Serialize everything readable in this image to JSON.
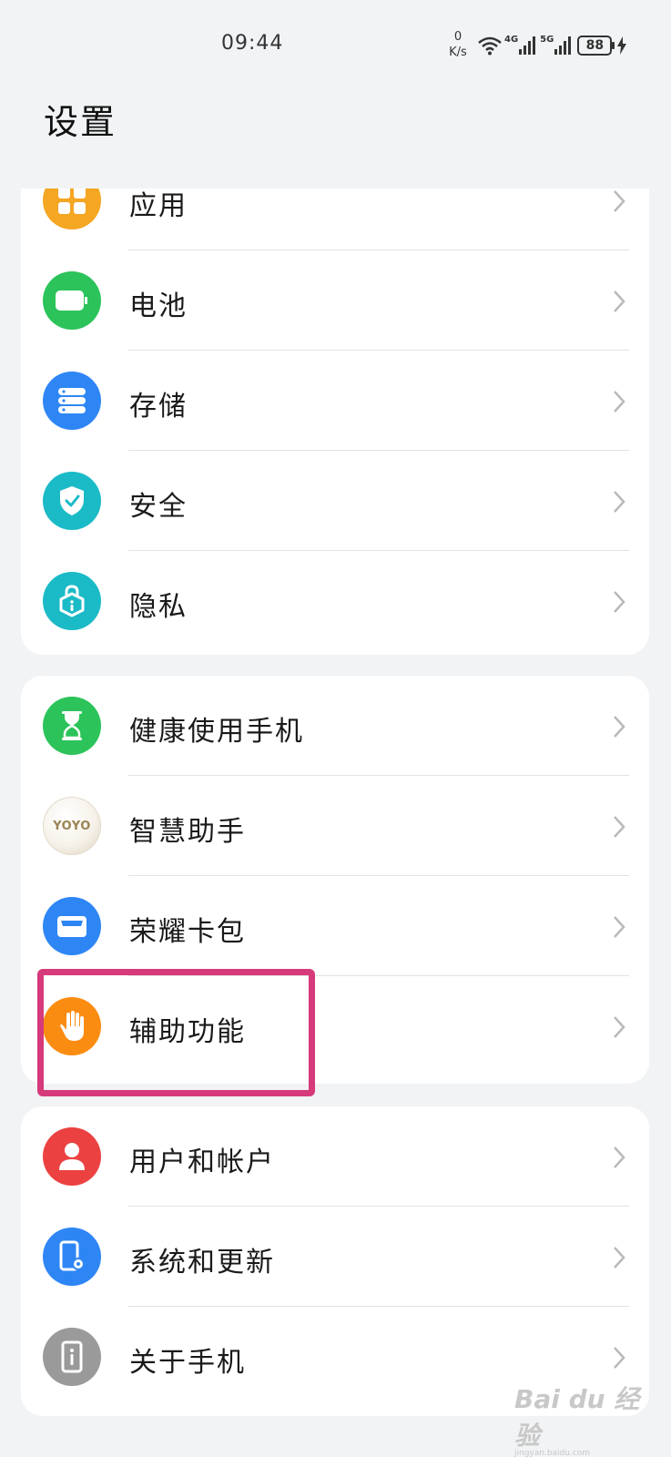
{
  "status_bar": {
    "time": "09:44",
    "net_speed_value": "0",
    "net_speed_unit": "K/s",
    "net_4g": "4G",
    "net_5g": "5G",
    "battery": "88"
  },
  "page_title": "设置",
  "groups": [
    {
      "items": [
        {
          "label": "应用",
          "icon": "apps-icon",
          "color": "#f5a623"
        },
        {
          "label": "电池",
          "icon": "battery-icon",
          "color": "#2bc35a"
        },
        {
          "label": "存储",
          "icon": "storage-icon",
          "color": "#2e86f5"
        },
        {
          "label": "安全",
          "icon": "shield-icon",
          "color": "#1bbac7"
        },
        {
          "label": "隐私",
          "icon": "privacy-lock-icon",
          "color": "#1bbac7"
        }
      ]
    },
    {
      "items": [
        {
          "label": "健康使用手机",
          "icon": "hourglass-icon",
          "color": "#2bc35a"
        },
        {
          "label": "智慧助手",
          "icon": "yoyo-assistant-icon",
          "icon_text": "YOYO",
          "color": "#f4efe3"
        },
        {
          "label": "荣耀卡包",
          "icon": "wallet-icon",
          "color": "#2e86f5"
        },
        {
          "label": "辅助功能",
          "icon": "hand-icon",
          "color": "#fb8c12"
        }
      ]
    },
    {
      "items": [
        {
          "label": "用户和帐户",
          "icon": "user-icon",
          "color": "#ec4141"
        },
        {
          "label": "系统和更新",
          "icon": "system-update-icon",
          "color": "#2e86f5"
        },
        {
          "label": "关于手机",
          "icon": "about-phone-icon",
          "color": "#9a9a9a"
        }
      ]
    }
  ],
  "watermark": {
    "text": "Bai du 经验",
    "subtext": "jingyan.baidu.com"
  }
}
